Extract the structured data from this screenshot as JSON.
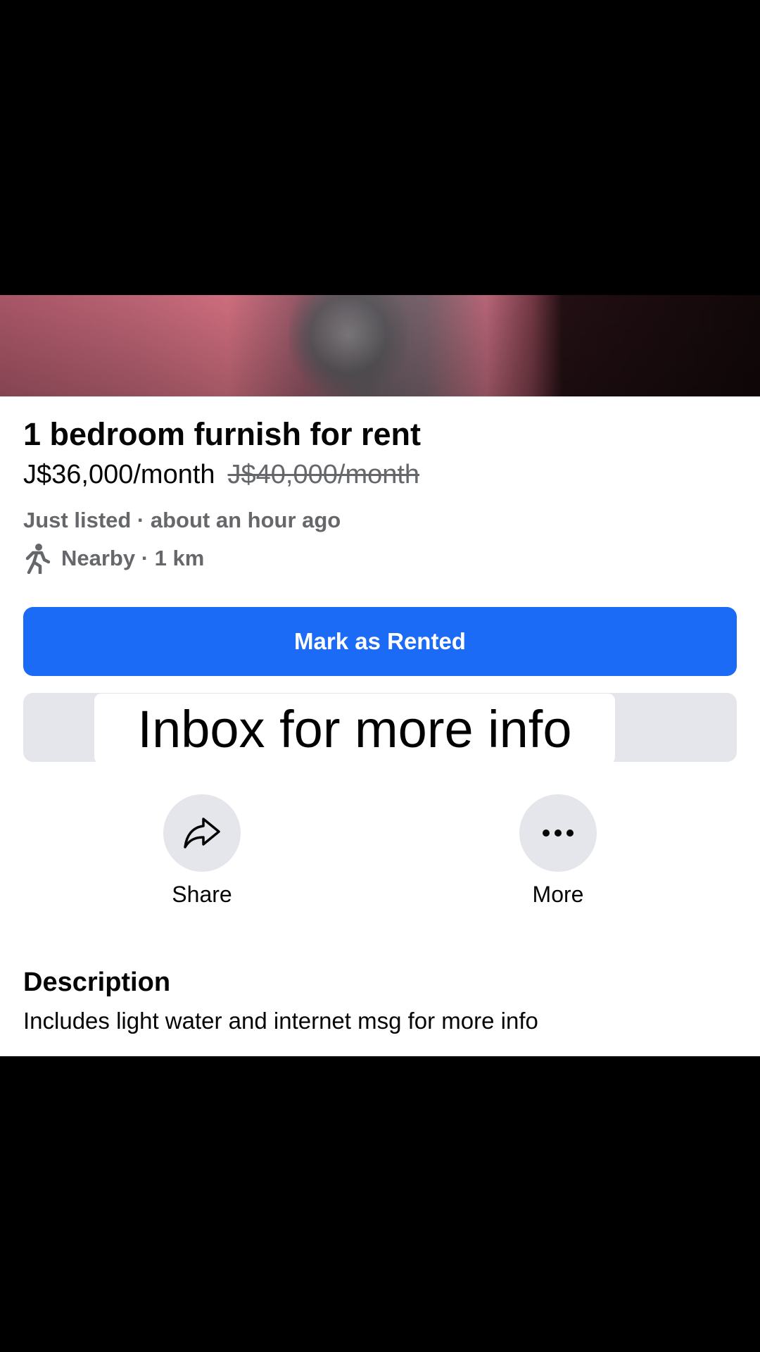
{
  "listing": {
    "title": "1 bedroom furnish for rent",
    "price": "J$36,000/month",
    "original_price": "J$40,000/month",
    "listed": "Just listed · about an hour ago",
    "distance": "Nearby · 1 km"
  },
  "buttons": {
    "mark_rented": "Mark as Rented"
  },
  "overlay": {
    "caption": "Inbox for more info"
  },
  "actions": {
    "share": "Share",
    "more": "More"
  },
  "description": {
    "heading": "Description",
    "body": "Includes light water and internet msg for more info"
  },
  "colors": {
    "primary": "#1b6bf6",
    "secondary_bg": "#e4e6eb",
    "muted_text": "#65676b"
  },
  "icons": {
    "walking": "walking-person-icon",
    "share": "share-arrow-icon",
    "more": "more-dots-icon"
  }
}
